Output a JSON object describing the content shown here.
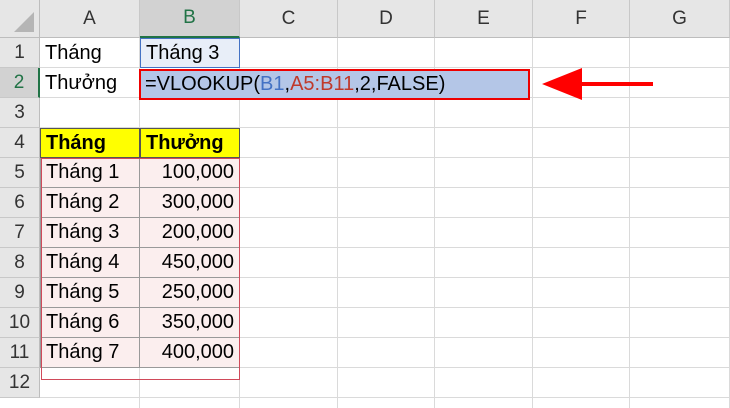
{
  "columns": [
    "A",
    "B",
    "C",
    "D",
    "E",
    "F",
    "G"
  ],
  "rows": [
    "1",
    "2",
    "3",
    "4",
    "5",
    "6",
    "7",
    "8",
    "9",
    "10",
    "11",
    "12"
  ],
  "cells": {
    "A1": "Tháng",
    "B1": "Tháng 3",
    "A2": "Thưởng"
  },
  "formula": {
    "prefix": "=VLOOKUP(",
    "ref1": "B1",
    "sep1": ",",
    "ref2": "A5:B11",
    "suffix": ",2,FALSE)"
  },
  "table": {
    "headers": [
      "Tháng",
      "Thưởng"
    ],
    "rows": [
      [
        "Tháng 1",
        "100,000"
      ],
      [
        "Tháng 2",
        "300,000"
      ],
      [
        "Tháng 3",
        "200,000"
      ],
      [
        "Tháng 4",
        "450,000"
      ],
      [
        "Tháng 5",
        "250,000"
      ],
      [
        "Tháng 6",
        "350,000"
      ],
      [
        "Tháng 7",
        "400,000"
      ]
    ]
  },
  "colors": {
    "ref1": "#4472c4",
    "ref2": "#c0392b",
    "highlight": "#b4c6e7",
    "arrow": "#ff0000",
    "header_fill": "#ffff00",
    "range_fill": "#fbeeee"
  }
}
